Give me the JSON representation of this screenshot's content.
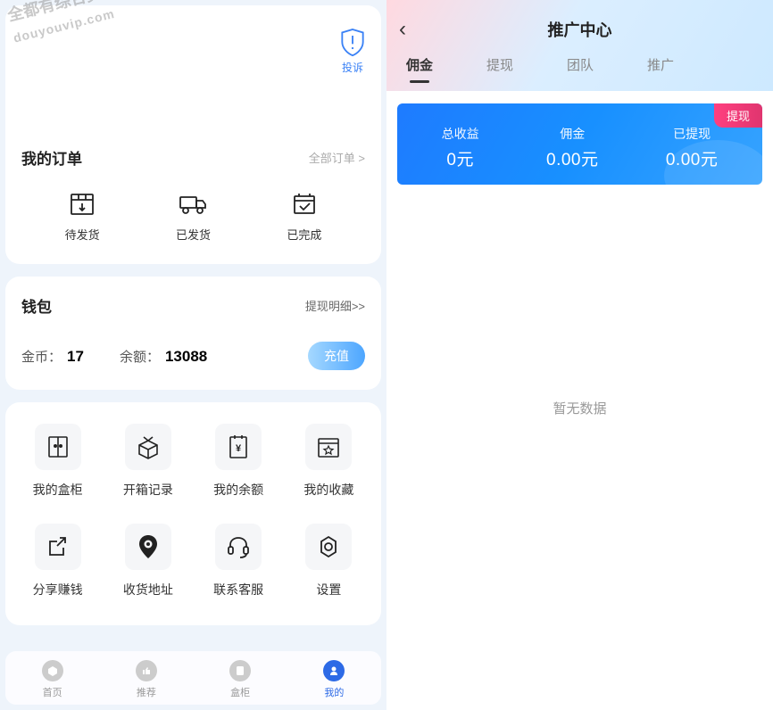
{
  "left": {
    "complaint": "投诉",
    "orders": {
      "title": "我的订单",
      "all": "全部订单 >",
      "items": [
        {
          "label": "待发货"
        },
        {
          "label": "已发货"
        },
        {
          "label": "已完成"
        }
      ]
    },
    "wallet": {
      "title": "钱包",
      "detail_link": "提现明细>>",
      "coin_label": "金币：",
      "coin_value": "17",
      "balance_label": "余额：",
      "balance_value": "13088",
      "recharge": "充值"
    },
    "grid": [
      {
        "label": "我的盒柜"
      },
      {
        "label": "开箱记录"
      },
      {
        "label": "我的余额"
      },
      {
        "label": "我的收藏"
      },
      {
        "label": "分享赚钱"
      },
      {
        "label": "收货地址"
      },
      {
        "label": "联系客服"
      },
      {
        "label": "设置"
      }
    ],
    "tabs": [
      {
        "label": "首页"
      },
      {
        "label": "推荐"
      },
      {
        "label": "盒柜"
      },
      {
        "label": "我的"
      }
    ],
    "watermark_line1": "全都有综合资源网",
    "watermark_line2": "douyouvip.com"
  },
  "right": {
    "header_title": "推广中心",
    "tabs": [
      {
        "label": "佣金"
      },
      {
        "label": "提现"
      },
      {
        "label": "团队"
      },
      {
        "label": "推广"
      }
    ],
    "banner": {
      "withdraw": "提现",
      "items": [
        {
          "label": "总收益",
          "value": "0元"
        },
        {
          "label": "佣金",
          "value": "0.00元"
        },
        {
          "label": "已提现",
          "value": "0.00元"
        }
      ]
    },
    "empty": "暂无数据"
  }
}
